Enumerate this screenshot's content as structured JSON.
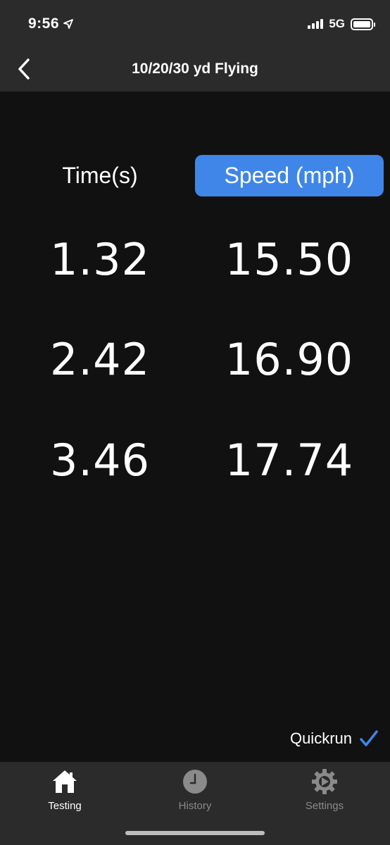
{
  "status": {
    "time": "9:56",
    "network": "5G"
  },
  "nav": {
    "title": "10/20/30 yd Flying"
  },
  "columns": {
    "time_label": "Time(s)",
    "speed_label": "Speed (mph)"
  },
  "rows": [
    {
      "time": "1.32",
      "speed": "15.50"
    },
    {
      "time": "2.42",
      "speed": "16.90"
    },
    {
      "time": "3.46",
      "speed": "17.74"
    }
  ],
  "quickrun": {
    "label": "Quickrun",
    "checked": true
  },
  "tabs": [
    {
      "label": "Testing",
      "icon": "home-icon",
      "active": true
    },
    {
      "label": "History",
      "icon": "clock-icon",
      "active": false
    },
    {
      "label": "Settings",
      "icon": "gear-icon",
      "active": false
    }
  ],
  "colors": {
    "accent": "#3f86e8",
    "background": "#111111",
    "bar": "#2b2b2b",
    "inactive": "#8a8a8a"
  }
}
